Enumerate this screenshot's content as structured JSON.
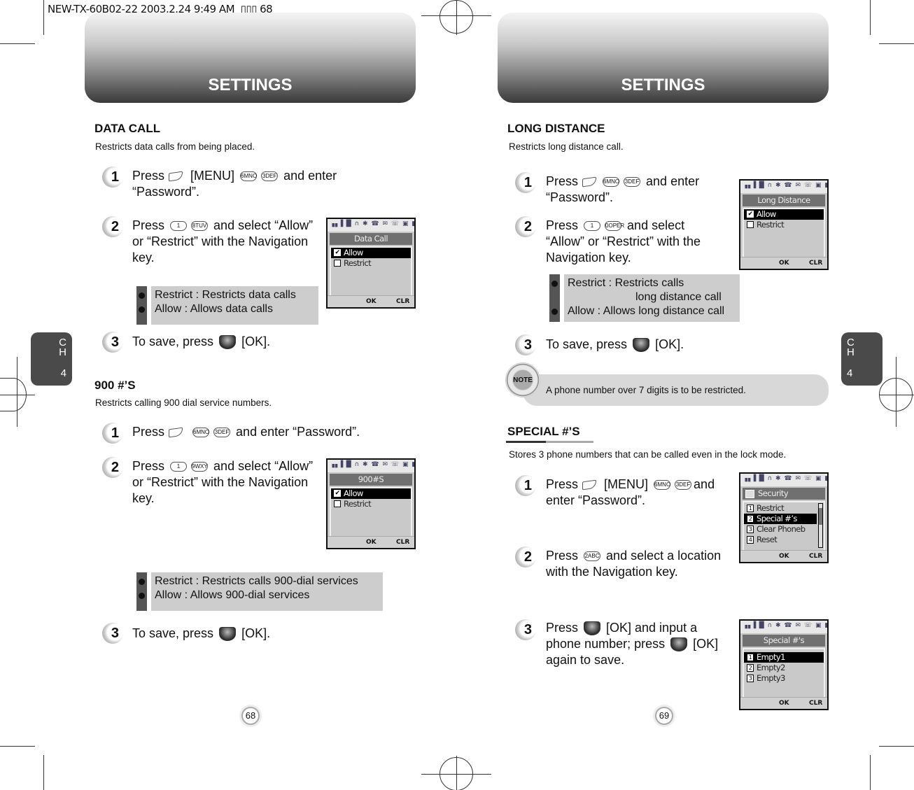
{
  "slug": "NEW-TX-60B02-22  2003.2.24 9:49 AM  ▯▯▯ 68",
  "pages": {
    "left": {
      "banner_title": "SETTINGS",
      "chapter_tab": {
        "letters": "C\nH",
        "number": "4"
      },
      "page_number": "68",
      "sections": [
        {
          "heading": "DATA CALL",
          "description": "Restricts data calls from being placed.",
          "steps": [
            {
              "num": "1",
              "text_a": "Press",
              "key_a": "[MENU]",
              "keys": [
                "6MNO",
                "3DEF"
              ],
              "text_b": "and enter",
              "text_c": "“Password”."
            },
            {
              "num": "2",
              "text_a": "Press",
              "keys": [
                "1",
                "8TUV"
              ],
              "text_b": "and select “Allow”",
              "text_c": "or “Restrict” with the Navigation",
              "text_d": "key."
            },
            {
              "num": "3",
              "text_a": "To save, press",
              "text_b": "[OK]."
            }
          ],
          "info": [
            "Restrict : Restricts data calls",
            "Allow : Allows data calls"
          ],
          "phone_screen": {
            "title": "Data Call",
            "options": [
              {
                "label": "Allow",
                "checked": true,
                "selected": true
              },
              {
                "label": "Restrict",
                "checked": false,
                "selected": false
              }
            ],
            "softkeys": [
              "OK",
              "CLR"
            ]
          }
        },
        {
          "heading": "900 #’S",
          "description": "Restricts calling 900 dial service numbers.",
          "steps": [
            {
              "num": "1",
              "text_a": "Press",
              "keys": [
                "6MNO",
                "3DEF"
              ],
              "text_b": "and enter “Password”."
            },
            {
              "num": "2",
              "text_a": "Press",
              "keys": [
                "1",
                "9WXY"
              ],
              "text_b": "and select “Allow”",
              "text_c": "or “Restrict” with the Navigation",
              "text_d": "key."
            },
            {
              "num": "3",
              "text_a": "To save, press",
              "text_b": "[OK]."
            }
          ],
          "info": [
            "Restrict : Restricts calls 900-dial services",
            "Allow : Allows 900-dial services"
          ],
          "phone_screen": {
            "title": "900#S",
            "options": [
              {
                "label": "Allow",
                "checked": true,
                "selected": true
              },
              {
                "label": "Restrict",
                "checked": false,
                "selected": false
              }
            ],
            "softkeys": [
              "OK",
              "CLR"
            ]
          }
        }
      ]
    },
    "right": {
      "banner_title": "SETTINGS",
      "chapter_tab": {
        "letters": "C\nH",
        "number": "4"
      },
      "page_number": "69",
      "sections": [
        {
          "heading": "LONG DISTANCE",
          "description": "Restricts long distance call.",
          "steps": [
            {
              "num": "1",
              "text_a": "Press",
              "keys": [
                "6MNO",
                "3DEF"
              ],
              "text_b": "and enter",
              "text_c": "“Password”."
            },
            {
              "num": "2",
              "text_a": "Press",
              "keys": [
                "1",
                "0OPER"
              ],
              "text_b": "and select",
              "text_c": "“Allow” or “Restrict” with the",
              "text_d": "Navigation key."
            },
            {
              "num": "3",
              "text_a": "To save, press",
              "text_b": "[OK]."
            }
          ],
          "info": [
            "Restrict : Restricts calls",
            "long distance call",
            "Allow : Allows long distance call"
          ],
          "phone_screen": {
            "title": "Long Distance",
            "options": [
              {
                "label": "Allow",
                "checked": true,
                "selected": true
              },
              {
                "label": "Restrict",
                "checked": false,
                "selected": false
              }
            ],
            "softkeys": [
              "OK",
              "CLR"
            ]
          }
        },
        {
          "heading": "SPECIAL #’S",
          "description": "Stores 3 phone numbers that can be called even in the lock mode.",
          "steps": [
            {
              "num": "1",
              "text_a": "Press",
              "key_a": "[MENU]",
              "keys": [
                "6MNO",
                "3DEF"
              ],
              "text_b": "and",
              "text_c": "enter “Password”."
            },
            {
              "num": "2",
              "text_a": "Press",
              "keys": [
                "2ABC"
              ],
              "text_b": "and select a location",
              "text_c": "with the Navigation key."
            },
            {
              "num": "3",
              "text_a": "Press",
              "text_b": "[OK] and input a",
              "text_c": "phone number; press",
              "text_d": "[OK]",
              "text_e": "again to save."
            }
          ],
          "phone_screens": [
            {
              "title": "Security",
              "options": [
                {
                  "index": "1",
                  "label": "Restrict",
                  "selected": false
                },
                {
                  "index": "2",
                  "label": "Special #’s",
                  "selected": true
                },
                {
                  "index": "3",
                  "label": "Clear Phoneb",
                  "selected": false
                },
                {
                  "index": "4",
                  "label": "Reset",
                  "selected": false
                }
              ],
              "softkeys": [
                "OK",
                "CLR"
              ]
            },
            {
              "title": "Special #'s",
              "options": [
                {
                  "index": "1",
                  "label": "Empty1",
                  "selected": true
                },
                {
                  "index": "2",
                  "label": "Empty2",
                  "selected": false
                },
                {
                  "index": "3",
                  "label": "Empty3",
                  "selected": false
                }
              ],
              "softkeys": [
                "OK",
                "CLR"
              ]
            }
          ]
        }
      ],
      "note": {
        "icon_label": "NOTE",
        "text": "A phone number over 7 digits is to be restricted."
      }
    }
  },
  "phone_status_icons": "▗▖▌█ ∩ ✱ ☎ ✉ ☏ ▣ ▮▮▮"
}
